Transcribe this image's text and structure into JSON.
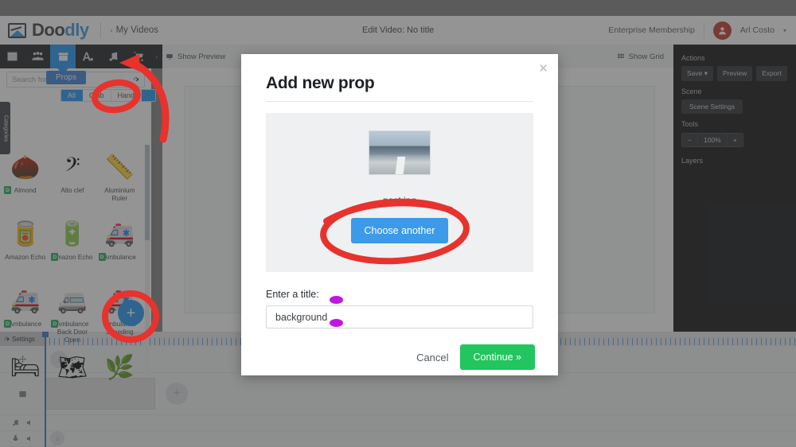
{
  "app": {
    "brand_first": "Doo",
    "brand_second": "dly",
    "my_videos": "My Videos",
    "back_chevron": "‹",
    "accent_blue": "#2196f3",
    "green": "#22c55e",
    "red_anno": "#e8322d",
    "magenta_anno": "#c217e0"
  },
  "header": {
    "title": "Edit Video: No title",
    "membership": "Enterprise Membership",
    "user_name": "Arl Costo",
    "user_caret": "▾",
    "avatar_icon": "user-icon"
  },
  "toolbar": {
    "tabs": [
      {
        "name": "image-icon",
        "label": "Images"
      },
      {
        "name": "characters-icon",
        "label": "Characters"
      },
      {
        "name": "props-icon",
        "label": "Props"
      },
      {
        "name": "text-icon",
        "label": "Text"
      },
      {
        "name": "music-icon",
        "label": "Music"
      },
      {
        "name": "cart-icon",
        "label": "Store"
      }
    ],
    "active_index": 2,
    "collapse_chevron": "‹"
  },
  "left_panel": {
    "search_placeholder": "Search for...",
    "settings_icon": "gear-icon",
    "tooltip": "Props",
    "categories_tab": "Categories",
    "filter_tabs": [
      {
        "label": "All",
        "active": true
      },
      {
        "label": "Club",
        "active": false
      },
      {
        "label": "Hand",
        "active": false
      }
    ],
    "add_button_label": "+",
    "items": [
      {
        "label": "Almond",
        "glyph": "🌰",
        "badge": "D"
      },
      {
        "label": "Alto clef",
        "glyph": "𝄢",
        "badge": ""
      },
      {
        "label": "Aluminium Ruler",
        "glyph": "📏",
        "badge": ""
      },
      {
        "label": "Amazon Echo",
        "glyph": "🥫",
        "badge": ""
      },
      {
        "label": "Amazon Echo",
        "glyph": "🔋",
        "badge": "D"
      },
      {
        "label": "Ambulance",
        "glyph": "🚑",
        "badge": "D"
      },
      {
        "label": "Ambulance",
        "glyph": "🚑",
        "badge": "D"
      },
      {
        "label": "Ambulance Back Door Open",
        "glyph": "🚐",
        "badge": "D"
      },
      {
        "label": "Ambulance Speeding",
        "glyph": "🚑",
        "badge": ""
      },
      {
        "label": "",
        "glyph": "🛏",
        "badge": ""
      },
      {
        "label": "",
        "glyph": "🗺",
        "badge": ""
      },
      {
        "label": "",
        "glyph": "🌿",
        "badge": ""
      }
    ]
  },
  "stage": {
    "show_preview": "Show Preview",
    "show_preview_icon": "monitor-icon",
    "show_grid": "Show Grid",
    "show_grid_icon": "grid-icon",
    "left_chevron": "‹",
    "right_chevron": "›"
  },
  "right_panel": {
    "sections": [
      {
        "heading": "Actions",
        "buttons": [
          "Save  ▾",
          "Preview",
          "Export"
        ]
      },
      {
        "heading": "Scene",
        "buttons": [
          "Scene Settings"
        ]
      }
    ],
    "tools_heading": "Tools",
    "zoom_minus": "−",
    "zoom_value": "100%",
    "zoom_plus": "+",
    "layers_heading": "Layers"
  },
  "timeline": {
    "settings_label": "Settings",
    "settings_icon": "gear-icon",
    "tracks": [
      {
        "icon": "move-icon",
        "name": "scene-track"
      },
      {
        "icon": "image-icon",
        "name": "image-track"
      },
      {
        "icon": "music-icon",
        "name": "music-track",
        "extra": "speaker-icon"
      },
      {
        "icon": "mic-icon",
        "name": "voice-track",
        "extra": "speaker-icon"
      }
    ],
    "add_clip_label": "+"
  },
  "modal": {
    "title": "Add new prop",
    "close_label": "✕",
    "file_name": "pest.jpg",
    "thumbnail_icon": "image-thumbnail",
    "choose_another": "Choose another",
    "title_label": "Enter a title:",
    "title_value": "background",
    "cancel": "Cancel",
    "continue": "Continue »"
  }
}
